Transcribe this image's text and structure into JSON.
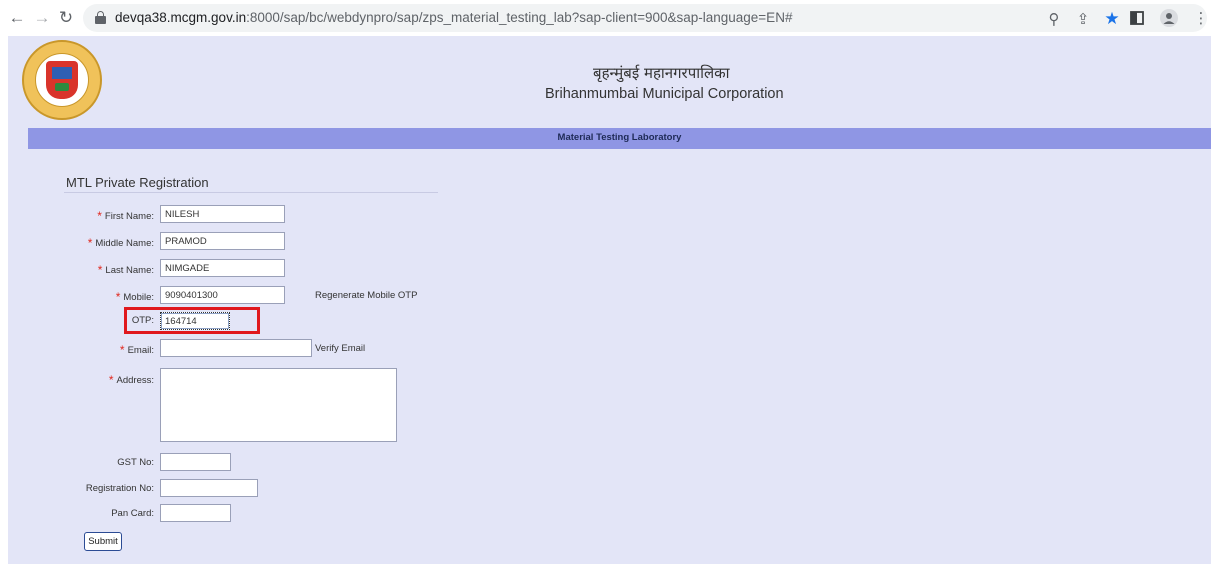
{
  "browser": {
    "back_icon": "arrow-left-icon",
    "forward_icon": "arrow-right-icon",
    "reload_icon": "reload-icon",
    "url_host": "devqa38.mcgm.gov.in",
    "url_path": ":8000/sap/bc/webdynpro/sap/zps_material_testing_lab?sap-client=900&sap-language=EN#",
    "toolbar_icons": [
      "zoom-icon",
      "share-icon",
      "bookmark-star-icon",
      "side-panel-icon",
      "profile-icon",
      "more-icon"
    ]
  },
  "header": {
    "title_hindi": "बृहन्मुंबई महानगरपालिका",
    "title_english": "Brihanmumbai Municipal Corporation",
    "banner_title": "Material Testing Laboratory"
  },
  "form": {
    "title": "MTL Private Registration",
    "first_name": {
      "label": "First Name:",
      "value": "NILESH"
    },
    "middle_name": {
      "label": "Middle Name:",
      "value": "PRAMOD"
    },
    "last_name": {
      "label": "Last Name:",
      "value": "NIMGADE"
    },
    "mobile": {
      "label": "Mobile:",
      "value": "9090401300",
      "action": "Regenerate Mobile OTP"
    },
    "otp": {
      "label": "OTP:",
      "value": "164714"
    },
    "email": {
      "label": "Email:",
      "value": "",
      "action": "Verify Email"
    },
    "address": {
      "label": "Address:",
      "value": ""
    },
    "gst": {
      "label": "GST No:",
      "value": ""
    },
    "registration": {
      "label": "Registration No:",
      "value": ""
    },
    "pan": {
      "label": "Pan Card:",
      "value": ""
    },
    "required_marker": "*",
    "submit_label": "Submit"
  },
  "colors": {
    "page_background": "#e3e5f7",
    "banner": "#8f96e4",
    "required": "#e0281e",
    "highlight": "#e0181e"
  }
}
